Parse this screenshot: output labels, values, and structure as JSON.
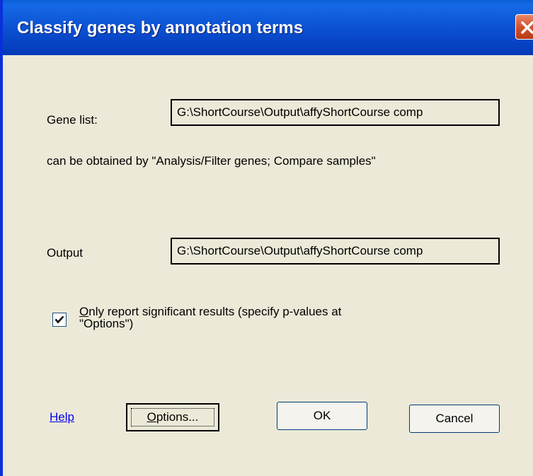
{
  "window": {
    "title": "Classify genes by annotation terms"
  },
  "form": {
    "gene_list_label": "Gene list:",
    "gene_list_value": "G:\\ShortCourse\\Output\\affyShortCourse comp",
    "hint_text": "can be obtained by \"Analysis/Filter genes; Compare samples\"",
    "output_label": "Output",
    "output_value": "G:\\ShortCourse\\Output\\affyShortCourse comp",
    "checkbox": {
      "checked": true,
      "mnemonic": "O",
      "label_rest": "nly report significant results (specify p-values at",
      "label_line2": "\"Options\")"
    }
  },
  "buttons": {
    "help_label": "Help",
    "options_mnemonic": "O",
    "options_rest": "ptions...",
    "ok_label": "OK",
    "cancel_label": "Cancel"
  },
  "icons": {
    "close": "close-icon",
    "check": "check-icon"
  },
  "colors": {
    "titlebar": "#0a4fd0",
    "dialog_bg": "#ece9d8",
    "close_button": "#d2522f",
    "link": "#0000ee"
  }
}
